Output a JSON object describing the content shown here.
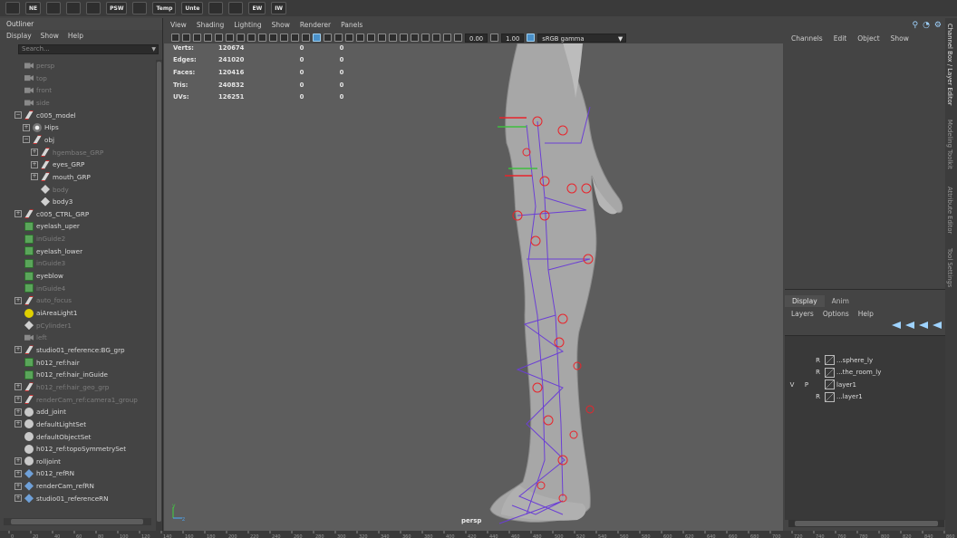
{
  "shelf": {
    "items": [
      "",
      "NE",
      "",
      "",
      "",
      "PSW",
      "",
      "Temp",
      "Unte",
      "",
      "",
      "EW",
      "IW"
    ]
  },
  "outliner": {
    "title": "Outliner",
    "menu": [
      "Display",
      "Show",
      "Help"
    ],
    "search_placeholder": "Search...",
    "items": [
      {
        "label": "persp",
        "icon": "camera-icon",
        "indent": 1,
        "expander": "",
        "dim": true
      },
      {
        "label": "top",
        "icon": "camera-icon",
        "indent": 1,
        "expander": "",
        "dim": true
      },
      {
        "label": "front",
        "icon": "camera-icon",
        "indent": 1,
        "expander": "",
        "dim": true
      },
      {
        "label": "side",
        "icon": "camera-icon",
        "indent": 1,
        "expander": "",
        "dim": true
      },
      {
        "label": "c005_model",
        "icon": "group-icon",
        "indent": 1,
        "expander": "−",
        "dim": false
      },
      {
        "label": "Hips",
        "icon": "joint-icon",
        "indent": 2,
        "expander": "+",
        "dim": false
      },
      {
        "label": "obj",
        "icon": "group-icon",
        "indent": 2,
        "expander": "−",
        "dim": false
      },
      {
        "label": "hgembase_GRP",
        "icon": "group-icon",
        "indent": 3,
        "expander": "+",
        "dim": true
      },
      {
        "label": "eyes_GRP",
        "icon": "group-icon",
        "indent": 3,
        "expander": "+",
        "dim": false
      },
      {
        "label": "mouth_GRP",
        "icon": "group-icon",
        "indent": 3,
        "expander": "+",
        "dim": false
      },
      {
        "label": "body",
        "icon": "mesh-icon",
        "indent": 3,
        "expander": "",
        "dim": true
      },
      {
        "label": "body3",
        "icon": "mesh-icon",
        "indent": 3,
        "expander": "",
        "dim": false
      },
      {
        "label": "c005_CTRL_GRP",
        "icon": "group-icon",
        "indent": 1,
        "expander": "+",
        "dim": false
      },
      {
        "label": "eyelash_uper",
        "icon": "curve-icon",
        "indent": 1,
        "expander": "",
        "dim": false
      },
      {
        "label": "inGuide2",
        "icon": "curve-icon",
        "indent": 1,
        "expander": "",
        "dim": true
      },
      {
        "label": "eyelash_lower",
        "icon": "curve-icon",
        "indent": 1,
        "expander": "",
        "dim": false
      },
      {
        "label": "inGuide3",
        "icon": "curve-icon",
        "indent": 1,
        "expander": "",
        "dim": true
      },
      {
        "label": "eyeblow",
        "icon": "curve-icon",
        "indent": 1,
        "expander": "",
        "dim": false
      },
      {
        "label": "inGuide4",
        "icon": "curve-icon",
        "indent": 1,
        "expander": "",
        "dim": true
      },
      {
        "label": "auto_focus",
        "icon": "group-icon",
        "indent": 1,
        "expander": "+",
        "dim": true
      },
      {
        "label": "aiAreaLight1",
        "icon": "light-icon",
        "indent": 1,
        "expander": "",
        "dim": false
      },
      {
        "label": "pCylinder1",
        "icon": "mesh-icon",
        "indent": 1,
        "expander": "",
        "dim": true
      },
      {
        "label": "left",
        "icon": "camera-icon",
        "indent": 1,
        "expander": "",
        "dim": true
      },
      {
        "label": "studio01_reference:BG_grp",
        "icon": "group-icon",
        "indent": 1,
        "expander": "+",
        "dim": false
      },
      {
        "label": "h012_ref:hair",
        "icon": "curve-icon",
        "indent": 1,
        "expander": "",
        "dim": false
      },
      {
        "label": "h012_ref:hair_inGuide",
        "icon": "curve-icon",
        "indent": 1,
        "expander": "",
        "dim": false
      },
      {
        "label": "h012_ref:hair_geo_grp",
        "icon": "group-icon",
        "indent": 1,
        "expander": "+",
        "dim": true
      },
      {
        "label": "renderCam_ref:camera1_group",
        "icon": "group-icon",
        "indent": 1,
        "expander": "+",
        "dim": true
      },
      {
        "label": "add_joint",
        "icon": "set-icon",
        "indent": 1,
        "expander": "+",
        "dim": false
      },
      {
        "label": "defaultLightSet",
        "icon": "set-icon",
        "indent": 1,
        "expander": "+",
        "dim": false
      },
      {
        "label": "defaultObjectSet",
        "icon": "set-icon",
        "indent": 1,
        "expander": "",
        "dim": false
      },
      {
        "label": "h012_ref:topoSymmetrySet",
        "icon": "set-icon",
        "indent": 1,
        "expander": "",
        "dim": false
      },
      {
        "label": "rolljoint",
        "icon": "set-icon",
        "indent": 1,
        "expander": "+",
        "dim": false
      },
      {
        "label": "h012_refRN",
        "icon": "reference-icon",
        "indent": 1,
        "expander": "+",
        "dim": false
      },
      {
        "label": "renderCam_refRN",
        "icon": "reference-icon",
        "indent": 1,
        "expander": "+",
        "dim": false
      },
      {
        "label": "studio01_referenceRN",
        "icon": "reference-icon",
        "indent": 1,
        "expander": "+",
        "dim": false
      }
    ]
  },
  "viewport": {
    "menu": [
      "View",
      "Shading",
      "Lighting",
      "Show",
      "Renderer",
      "Panels"
    ],
    "near_value": "0.00",
    "far_value": "1.00",
    "color_space": "sRGB gamma",
    "hud": [
      {
        "label": "Verts:",
        "v1": "120674",
        "v2": "0",
        "v3": "0"
      },
      {
        "label": "Edges:",
        "v1": "241020",
        "v2": "0",
        "v3": "0"
      },
      {
        "label": "Faces:",
        "v1": "120416",
        "v2": "0",
        "v3": "0"
      },
      {
        "label": "Tris:",
        "v1": "240832",
        "v2": "0",
        "v3": "0"
      },
      {
        "label": "UVs:",
        "v1": "126251",
        "v2": "0",
        "v3": "0"
      }
    ],
    "camera": "persp",
    "axis_y": "y",
    "axis_z": "z"
  },
  "channel_box": {
    "menu": [
      "Channels",
      "Edit",
      "Object",
      "Show"
    ]
  },
  "layer_editor": {
    "tabs": [
      "Display",
      "Anim"
    ],
    "menu": [
      "Layers",
      "Options",
      "Help"
    ],
    "layers": [
      {
        "v": "",
        "p": "",
        "r": "R",
        "name": "...sphere_ly"
      },
      {
        "v": "",
        "p": "",
        "r": "R",
        "name": "...the_room_ly"
      },
      {
        "v": "V",
        "p": "P",
        "r": "",
        "name": "layer1"
      },
      {
        "v": "",
        "p": "",
        "r": "R",
        "name": "...layer1"
      }
    ]
  },
  "side_tabs": [
    "Channel Box / Layer Editor",
    "Modeling Toolkit",
    "Attribute Editor",
    "Tool Settings"
  ],
  "timeline": {
    "ticks": [
      "0",
      "20",
      "40",
      "60",
      "80",
      "100",
      "120",
      "140",
      "160",
      "180",
      "200",
      "220",
      "240",
      "260",
      "280",
      "300",
      "320",
      "340",
      "360",
      "380",
      "400",
      "420",
      "440",
      "460",
      "480",
      "500",
      "520",
      "540",
      "560",
      "580",
      "600",
      "620",
      "640",
      "660",
      "680",
      "700",
      "720",
      "740",
      "760",
      "780",
      "800",
      "820",
      "840",
      "860"
    ]
  },
  "colors": {
    "joint_color": "#e8242b",
    "bone_color": "#6b3fd4",
    "accent": "#4a90c8"
  }
}
